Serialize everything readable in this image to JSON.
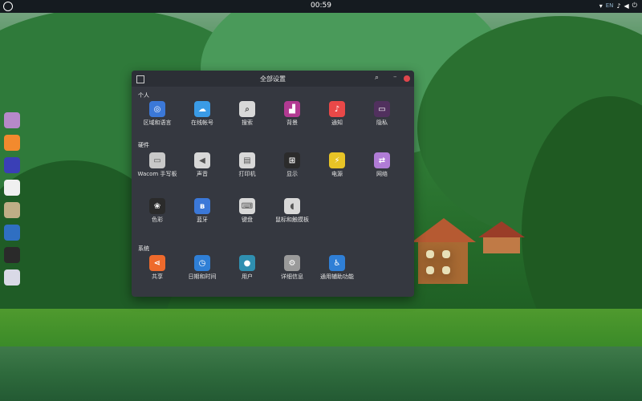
{
  "topbar": {
    "time": "00:59",
    "lang": "EN",
    "icons": [
      "activities-icon",
      "wifi-icon",
      "notification-icon",
      "volume-icon",
      "power-icon"
    ]
  },
  "dock": {
    "items": [
      {
        "name": "files",
        "color": "#b689c9"
      },
      {
        "name": "browser",
        "color": "#f28a2e"
      },
      {
        "name": "video",
        "color": "#3a3fb6"
      },
      {
        "name": "music",
        "color": "#f0f0f0"
      },
      {
        "name": "photos",
        "color": "#bfae86"
      },
      {
        "name": "camera",
        "color": "#2f6fc2"
      },
      {
        "name": "terminal",
        "color": "#2a2a2a"
      },
      {
        "name": "settings",
        "color": "#d9d9e6"
      }
    ]
  },
  "window": {
    "title": "全部设置",
    "sections": {
      "personal": "个人",
      "hardware": "硬件",
      "system": "系统"
    },
    "personal": [
      {
        "label": "区域和语言",
        "icon": "globe-icon",
        "color": "#3b78d8"
      },
      {
        "label": "在线帐号",
        "icon": "cloud-icon",
        "color": "#3a9be6"
      },
      {
        "label": "搜索",
        "icon": "search-icon",
        "color": "#d8d8d8"
      },
      {
        "label": "背景",
        "icon": "background-icon",
        "color": "#b23a92"
      },
      {
        "label": "通知",
        "icon": "bell-icon",
        "color": "#e94848"
      },
      {
        "label": "隐私",
        "icon": "privacy-icon",
        "color": "#51305e"
      }
    ],
    "hardware": [
      {
        "label": "Wacom 手写板",
        "icon": "tablet-icon",
        "color": "#c8c8c8"
      },
      {
        "label": "声音",
        "icon": "speaker-icon",
        "color": "#d8d8d8"
      },
      {
        "label": "打印机",
        "icon": "printer-icon",
        "color": "#d8d8d8"
      },
      {
        "label": "显示",
        "icon": "display-icon",
        "color": "#2b2b2b"
      },
      {
        "label": "电源",
        "icon": "power-icon",
        "color": "#e8c426"
      },
      {
        "label": "网络",
        "icon": "network-icon",
        "color": "#b07cd6"
      },
      {
        "label": "色彩",
        "icon": "color-icon",
        "color": "#2b2b2b"
      },
      {
        "label": "蓝牙",
        "icon": "bluetooth-icon",
        "color": "#3b78d8"
      },
      {
        "label": "键盘",
        "icon": "keyboard-icon",
        "color": "#d8d8d8"
      },
      {
        "label": "鼠标和触摸板",
        "icon": "mouse-icon",
        "color": "#d8d8d8"
      }
    ],
    "system": [
      {
        "label": "共享",
        "icon": "share-icon",
        "color": "#ee6a2c"
      },
      {
        "label": "日期和时间",
        "icon": "clock-icon",
        "color": "#2f7fd6"
      },
      {
        "label": "用户",
        "icon": "user-icon",
        "color": "#2f8fb0"
      },
      {
        "label": "详细信息",
        "icon": "gear-icon",
        "color": "#9a9a9a"
      },
      {
        "label": "通用辅助功能",
        "icon": "accessibility-icon",
        "color": "#2f7fd6"
      }
    ]
  }
}
